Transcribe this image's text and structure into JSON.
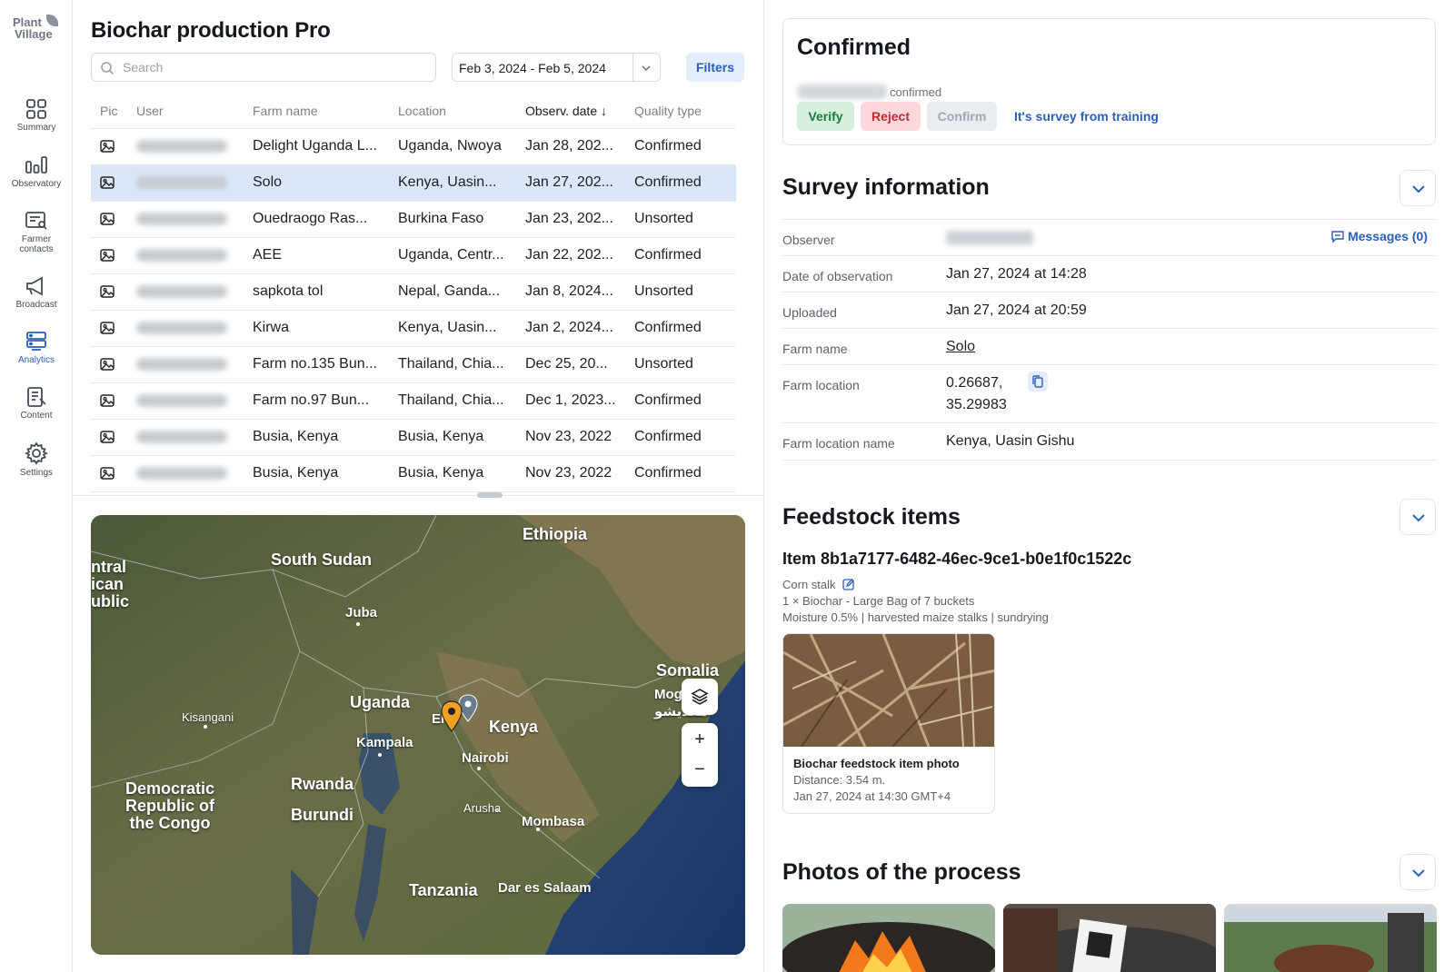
{
  "sidebar": {
    "logo_line1": "Plant",
    "logo_line2": "Village",
    "items": [
      {
        "label": "Summary"
      },
      {
        "label": "Observatory"
      },
      {
        "label": "Farmer contacts"
      },
      {
        "label": "Broadcast"
      },
      {
        "label": "Analytics"
      },
      {
        "label": "Content"
      },
      {
        "label": "Settings"
      }
    ],
    "active_item": "Analytics",
    "accent_color": "#2c5fb8"
  },
  "list": {
    "title": "Biochar production Pro",
    "search_placeholder": "Search",
    "search_value": "",
    "date_range": "Feb 3, 2024 - Feb 5, 2024",
    "filters_label": "Filters",
    "columns": [
      "Pic",
      "User",
      "Farm name",
      "Location",
      "Observ. date ↓",
      "Quality type"
    ],
    "rows": [
      {
        "farm": "Delight Uganda L...",
        "location": "Uganda, Nwoya",
        "date": "Jan 28, 202...",
        "quality": "Confirmed",
        "selected": false
      },
      {
        "farm": "Solo",
        "location": "Kenya, Uasin...",
        "date": "Jan 27, 202...",
        "quality": "Confirmed",
        "selected": true
      },
      {
        "farm": "Ouedraogo Ras...",
        "location": "Burkina Faso",
        "date": "Jan 23, 202...",
        "quality": "Unsorted",
        "selected": false
      },
      {
        "farm": "AEE",
        "location": "Uganda, Centr...",
        "date": "Jan 22, 202...",
        "quality": "Confirmed",
        "selected": false
      },
      {
        "farm": "sapkota tol",
        "location": "Nepal, Ganda...",
        "date": "Jan 8, 2024...",
        "quality": "Unsorted",
        "selected": false
      },
      {
        "farm": "Kirwa",
        "location": "Kenya, Uasin...",
        "date": "Jan 2, 2024...",
        "quality": "Confirmed",
        "selected": false
      },
      {
        "farm": "Farm no.135 Bun...",
        "location": "Thailand, Chia...",
        "date": "Dec 25, 20...",
        "quality": "Unsorted",
        "selected": false
      },
      {
        "farm": "Farm no.97 Bun...",
        "location": "Thailand, Chia...",
        "date": "Dec 1, 2023...",
        "quality": "Confirmed",
        "selected": false
      },
      {
        "farm": "Busia, Kenya",
        "location": "Busia, Kenya",
        "date": "Nov 23, 2022",
        "quality": "Confirmed",
        "selected": false
      },
      {
        "farm": "Busia, Kenya",
        "location": "Busia, Kenya",
        "date": "Nov 23, 2022",
        "quality": "Confirmed",
        "selected": false
      }
    ]
  },
  "map": {
    "labels": {
      "ethiopia": "Ethiopia",
      "south_sudan": "South Sudan",
      "car": "ntral\nican\nublic",
      "juba": "Juba",
      "somalia": "Somalia",
      "mogadishu": "Mogad\nمقديشو",
      "uganda": "Uganda",
      "kenya": "Kenya",
      "kisangani": "Kisangani",
      "kampala": "Kampala",
      "nairobi": "Nairobi",
      "drc": "Democratic\nRepublic of\nthe Congo",
      "rwanda": "Rwanda",
      "burundi": "Burundi",
      "arusha": "Arusha",
      "mombasa": "Mombasa",
      "tanzania": "Tanzania",
      "dar": "Dar es Salaam",
      "eldoret_partial": "El"
    },
    "zoom_in": "+",
    "zoom_out": "−"
  },
  "detail": {
    "status_title": "Confirmed",
    "status_sub": "confirmed",
    "actions": {
      "verify": "Verify",
      "reject": "Reject",
      "confirm": "Confirm",
      "training_link": "It's survey from training"
    },
    "survey_section_title": "Survey information",
    "survey": {
      "observer_label": "Observer",
      "messages_link": "Messages (0)",
      "date_label": "Date of observation",
      "date_value": "Jan 27, 2024 at 14:28",
      "uploaded_label": "Uploaded",
      "uploaded_value": "Jan 27, 2024 at 20:59",
      "farm_name_label": "Farm name",
      "farm_name_value": "Solo",
      "farm_location_label": "Farm location",
      "farm_lat": "0.26687,",
      "farm_lng": "35.29983",
      "farm_location_name_label": "Farm location name",
      "farm_location_name_value": "Kenya, Uasin Gishu"
    },
    "feedstock_section_title": "Feedstock items",
    "feedstock": {
      "item_title": "Item 8b1a7177-6482-46ec-9ce1-b0e1f0c1522c",
      "type": "Corn stalk",
      "quantity": "1 × Biochar - Large Bag of 7 buckets",
      "details": "Moisture 0.5% | harvested maize stalks | sundrying",
      "photo_caption": "Biochar feedstock item photo",
      "photo_distance": "Distance: 3.54 m.",
      "photo_time": "Jan 27, 2024 at 14:30 GMT+4"
    },
    "process_section_title": "Photos of the process"
  },
  "colors": {
    "accent": "#2c5fb8",
    "selected_row": "#dbe6f9",
    "verify_bg": "#d5f0dc",
    "reject_bg": "#fbd9db",
    "pin_orange": "#f0a020",
    "pin_grey": "#6b7c8c"
  }
}
